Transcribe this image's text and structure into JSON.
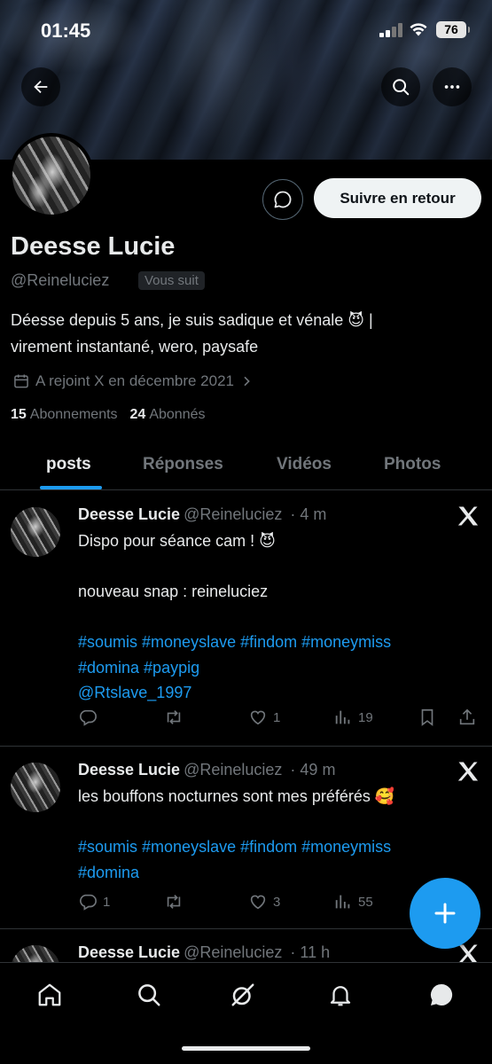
{
  "status_bar": {
    "time": "01:45",
    "battery": "76"
  },
  "profile": {
    "name": "Deesse Lucie",
    "handle": "@Reineluciez",
    "follows_you": "Vous suit",
    "bio_line1": "Déesse depuis 5 ans, je suis sadique et vénale 😈 |",
    "bio_line2": "virement instantané, wero, paysafe",
    "joined": "A rejoint X en décembre 2021",
    "following_count": "15",
    "following_label": "Abonnements",
    "followers_count": "24",
    "followers_label": "Abonnés",
    "follow_back_label": "Suivre en retour"
  },
  "tabs": [
    {
      "label": "posts",
      "active": true
    },
    {
      "label": "Réponses",
      "active": false
    },
    {
      "label": "Vidéos",
      "active": false
    },
    {
      "label": "Photos",
      "active": false
    }
  ],
  "posts": [
    {
      "name": "Deesse Lucie",
      "handle": "@Reineluciez",
      "time": "· 4 m",
      "line1": "Dispo pour séance cam ! 😈",
      "line2": "nouveau snap : reineluciez",
      "tags1": "#soumis #moneyslave #findom #moneymiss",
      "tags2": "#domina #paypig",
      "mention": "@Rtslave_1997",
      "replies": "",
      "reposts": "",
      "likes": "1",
      "views": "19"
    },
    {
      "name": "Deesse Lucie",
      "handle": "@Reineluciez",
      "time": "· 49 m",
      "line1": "les bouffons nocturnes sont mes préférés 🥰",
      "tags1": "#soumis #moneyslave #findom #moneymiss",
      "tags2": "#domina",
      "replies": "1",
      "reposts": "",
      "likes": "3",
      "views": "55"
    },
    {
      "name": "Deesse Lucie",
      "handle": "@Reineluciez",
      "time": "· 11 h"
    }
  ],
  "icons": {
    "back": "arrow-left-icon",
    "search": "search-icon",
    "more": "more-icon",
    "message": "message-icon",
    "calendar": "calendar-icon",
    "x_logo": "x-logo-icon",
    "compose": "plus-icon",
    "nav": [
      "home-icon",
      "search-icon",
      "grok-icon",
      "bell-icon",
      "messages-icon"
    ]
  },
  "colors": {
    "accent": "#1d9bf0",
    "background": "#000000",
    "text": "#e7e9ea",
    "muted": "#71767b"
  }
}
